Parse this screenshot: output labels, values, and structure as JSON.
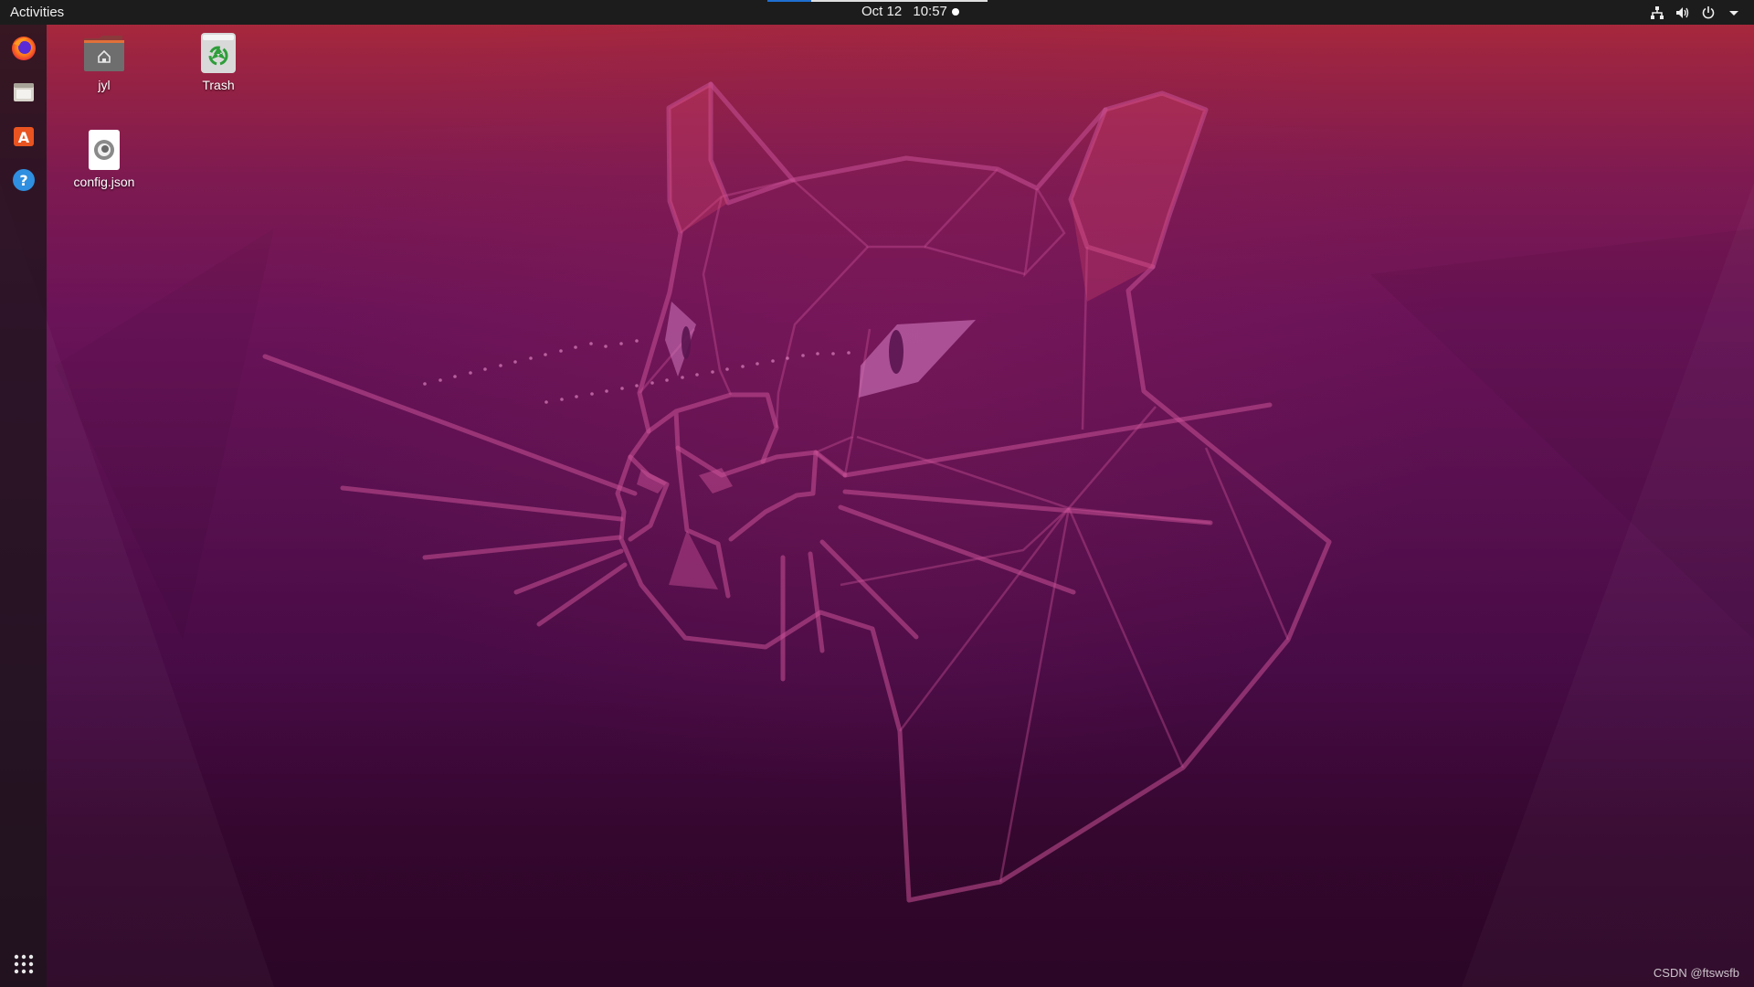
{
  "topbar": {
    "activities_label": "Activities",
    "date": "Oct 12",
    "time": "10:57",
    "tray_icons": [
      "network-icon",
      "volume-icon",
      "power-icon",
      "chevron-down-icon"
    ]
  },
  "dock": {
    "items": [
      {
        "name": "firefox-icon"
      },
      {
        "name": "files-icon"
      },
      {
        "name": "software-icon"
      },
      {
        "name": "help-icon"
      }
    ],
    "show_apps_icon": "grid-icon"
  },
  "desktop": {
    "icons": [
      {
        "label": "jyl",
        "icon": "home-folder-icon"
      },
      {
        "label": "Trash",
        "icon": "trash-icon"
      },
      {
        "label": "config.json",
        "icon": "json-file-icon"
      }
    ]
  },
  "watermark": "CSDN @ftswsfb",
  "colors": {
    "topbar_bg": "#1c1c1c",
    "wallpaper_top": "#b02a37",
    "wallpaper_bottom": "#2b0626",
    "accent_orange": "#e95420"
  }
}
